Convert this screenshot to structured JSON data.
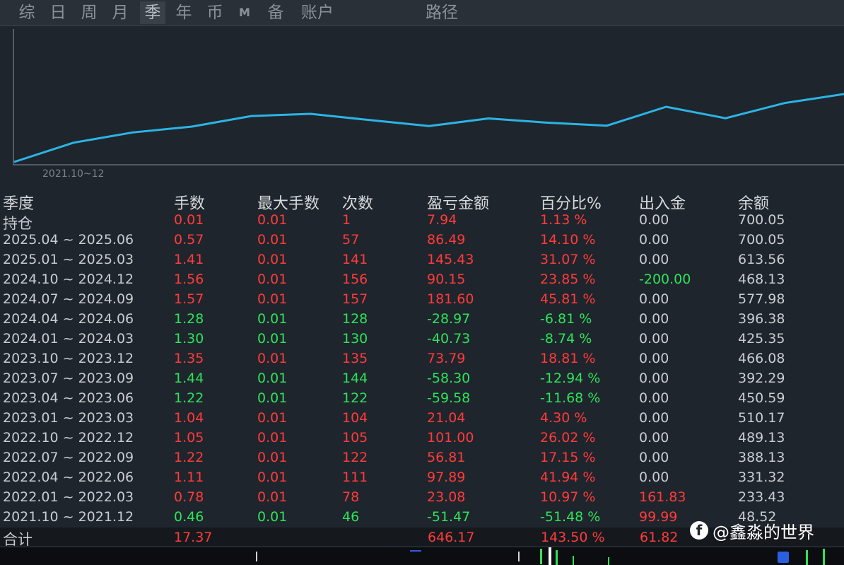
{
  "tabs": [
    {
      "label": "综",
      "active": false
    },
    {
      "label": "日",
      "active": false
    },
    {
      "label": "周",
      "active": false
    },
    {
      "label": "月",
      "active": false
    },
    {
      "label": "季",
      "active": true
    },
    {
      "label": "年",
      "active": false
    },
    {
      "label": "币",
      "active": false
    },
    {
      "label": "M",
      "active": false
    },
    {
      "label": "备",
      "active": false
    },
    {
      "label": "账户",
      "active": false
    },
    {
      "label": "路径",
      "active": false
    }
  ],
  "chart_data": {
    "type": "line",
    "x_tick_label": "2021.10~12",
    "series": [
      {
        "values": [
          48.52,
          233.43,
          331.32,
          388.13,
          489.13,
          510.17,
          450.59,
          392.29,
          466.08,
          425.35,
          396.38,
          577.98,
          468.13,
          613.56,
          700.05
        ]
      }
    ],
    "line_color": "#2bb4e6",
    "grid": false
  },
  "table": {
    "headers": [
      "季度",
      "手数",
      "最大手数",
      "次数",
      "盈亏金额",
      "百分比%",
      "出入金",
      "余额"
    ],
    "rows": [
      {
        "period": "持仓",
        "lots": "0.01",
        "max_lots": "0.01",
        "count": "1",
        "pnl": "7.94",
        "pct": "1.13 %",
        "flow": "0.00",
        "balance": "700.05",
        "sign": "pos",
        "flow_sign": "zero"
      },
      {
        "period": "2025.04 ~ 2025.06",
        "lots": "0.57",
        "max_lots": "0.01",
        "count": "57",
        "pnl": "86.49",
        "pct": "14.10 %",
        "flow": "0.00",
        "balance": "700.05",
        "sign": "pos",
        "flow_sign": "zero"
      },
      {
        "period": "2025.01 ~ 2025.03",
        "lots": "1.41",
        "max_lots": "0.01",
        "count": "141",
        "pnl": "145.43",
        "pct": "31.07 %",
        "flow": "0.00",
        "balance": "613.56",
        "sign": "pos",
        "flow_sign": "zero"
      },
      {
        "period": "2024.10 ~ 2024.12",
        "lots": "1.56",
        "max_lots": "0.01",
        "count": "156",
        "pnl": "90.15",
        "pct": "23.85 %",
        "flow": "-200.00",
        "balance": "468.13",
        "sign": "pos",
        "flow_sign": "neg"
      },
      {
        "period": "2024.07 ~ 2024.09",
        "lots": "1.57",
        "max_lots": "0.01",
        "count": "157",
        "pnl": "181.60",
        "pct": "45.81 %",
        "flow": "0.00",
        "balance": "577.98",
        "sign": "pos",
        "flow_sign": "zero"
      },
      {
        "period": "2024.04 ~ 2024.06",
        "lots": "1.28",
        "max_lots": "0.01",
        "count": "128",
        "pnl": "-28.97",
        "pct": "-6.81 %",
        "flow": "0.00",
        "balance": "396.38",
        "sign": "neg",
        "flow_sign": "zero"
      },
      {
        "period": "2024.01 ~ 2024.03",
        "lots": "1.30",
        "max_lots": "0.01",
        "count": "130",
        "pnl": "-40.73",
        "pct": "-8.74 %",
        "flow": "0.00",
        "balance": "425.35",
        "sign": "neg",
        "flow_sign": "zero"
      },
      {
        "period": "2023.10 ~ 2023.12",
        "lots": "1.35",
        "max_lots": "0.01",
        "count": "135",
        "pnl": "73.79",
        "pct": "18.81 %",
        "flow": "0.00",
        "balance": "466.08",
        "sign": "pos",
        "flow_sign": "zero"
      },
      {
        "period": "2023.07 ~ 2023.09",
        "lots": "1.44",
        "max_lots": "0.01",
        "count": "144",
        "pnl": "-58.30",
        "pct": "-12.94 %",
        "flow": "0.00",
        "balance": "392.29",
        "sign": "neg",
        "flow_sign": "zero"
      },
      {
        "period": "2023.04 ~ 2023.06",
        "lots": "1.22",
        "max_lots": "0.01",
        "count": "122",
        "pnl": "-59.58",
        "pct": "-11.68 %",
        "flow": "0.00",
        "balance": "450.59",
        "sign": "neg",
        "flow_sign": "zero"
      },
      {
        "period": "2023.01 ~ 2023.03",
        "lots": "1.04",
        "max_lots": "0.01",
        "count": "104",
        "pnl": "21.04",
        "pct": "4.30 %",
        "flow": "0.00",
        "balance": "510.17",
        "sign": "pos",
        "flow_sign": "zero"
      },
      {
        "period": "2022.10 ~ 2022.12",
        "lots": "1.05",
        "max_lots": "0.01",
        "count": "105",
        "pnl": "101.00",
        "pct": "26.02 %",
        "flow": "0.00",
        "balance": "489.13",
        "sign": "pos",
        "flow_sign": "zero"
      },
      {
        "period": "2022.07 ~ 2022.09",
        "lots": "1.22",
        "max_lots": "0.01",
        "count": "122",
        "pnl": "56.81",
        "pct": "17.15 %",
        "flow": "0.00",
        "balance": "388.13",
        "sign": "pos",
        "flow_sign": "zero"
      },
      {
        "period": "2022.04 ~ 2022.06",
        "lots": "1.11",
        "max_lots": "0.01",
        "count": "111",
        "pnl": "97.89",
        "pct": "41.94 %",
        "flow": "0.00",
        "balance": "331.32",
        "sign": "pos",
        "flow_sign": "zero"
      },
      {
        "period": "2022.01 ~ 2022.03",
        "lots": "0.78",
        "max_lots": "0.01",
        "count": "78",
        "pnl": "23.08",
        "pct": "10.97 %",
        "flow": "161.83",
        "balance": "233.43",
        "sign": "pos",
        "flow_sign": "pos"
      },
      {
        "period": "2021.10 ~ 2021.12",
        "lots": "0.46",
        "max_lots": "0.01",
        "count": "46",
        "pnl": "-51.47",
        "pct": "-51.48 %",
        "flow": "99.99",
        "balance": "48.52",
        "sign": "neg",
        "flow_sign": "pos"
      }
    ],
    "total": {
      "label": "合计",
      "lots": "17.37",
      "pnl": "646.17",
      "pct": "143.50 %",
      "flow": "61.82"
    }
  },
  "watermark": {
    "icon": "facebook-icon",
    "text": "@鑫淼的世界"
  },
  "colors": {
    "positive": "#ff3b3b",
    "negative": "#2de35a",
    "neutral": "#c9ccd0",
    "line": "#2bb4e6"
  }
}
